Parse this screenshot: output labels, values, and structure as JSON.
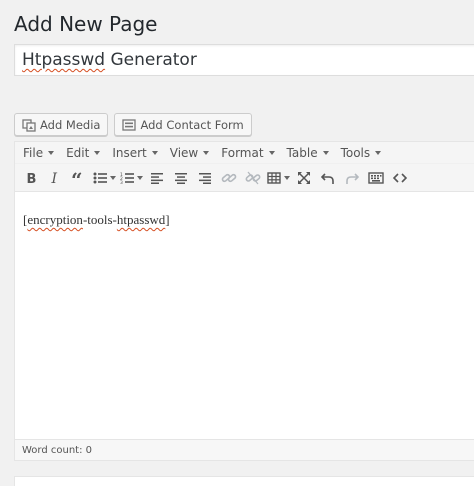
{
  "page_title": "Add New Page",
  "title_input": {
    "value_plain": "",
    "value_spell": "Htpasswd",
    "value_rest": " Generator"
  },
  "media_buttons": {
    "add_media": "Add Media",
    "add_contact_form": "Add Contact Form"
  },
  "menubar": {
    "items": [
      "File",
      "Edit",
      "Insert",
      "View",
      "Format",
      "Table",
      "Tools"
    ]
  },
  "toolbar": {
    "icons": [
      "bold-icon",
      "italic-icon",
      "blockquote-icon",
      "bullet-list-icon",
      "numbered-list-icon",
      "align-left-icon",
      "align-center-icon",
      "align-right-icon",
      "link-icon",
      "unlink-icon",
      "table-icon",
      "fullscreen-icon",
      "undo-icon",
      "redo-icon",
      "keyboard-icon",
      "code-icon"
    ]
  },
  "editor": {
    "content_open": "[",
    "content_word1": "encryption",
    "content_mid": "-tools-",
    "content_word2": "htpasswd",
    "content_close": "]"
  },
  "status": {
    "word_count": "Word count: 0"
  },
  "colors": {
    "accent": "#0073aa",
    "spellcheck": "#d54e21",
    "background": "#f1f1f1"
  }
}
